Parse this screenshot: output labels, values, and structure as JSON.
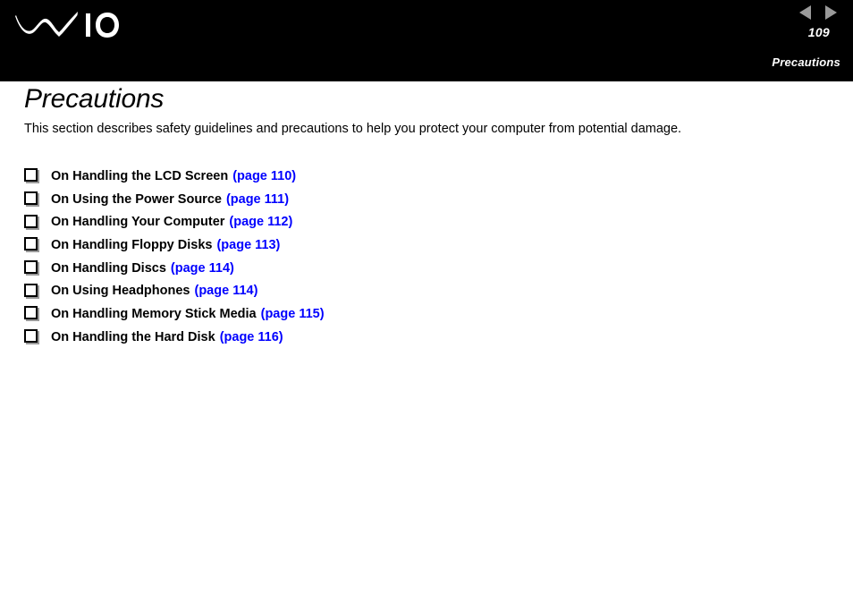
{
  "header": {
    "logo_name": "vaio-logo",
    "logo_text": "VAIO",
    "prev_arrow_label": "◀",
    "next_arrow_label": "▶",
    "page_number": "109",
    "section_label": "Precautions",
    "arrow_color": "#9a9a9a",
    "band_color": "#000000",
    "text_color": "#ffffff"
  },
  "main": {
    "title": "Precautions",
    "intro": "This section describes safety guidelines and precautions to help you protect your computer from potential damage.",
    "link_color": "#0000ff",
    "items": [
      {
        "label": "On Handling the LCD Screen",
        "page_ref": "(page 110)"
      },
      {
        "label": "On Using the Power Source",
        "page_ref": "(page 111)"
      },
      {
        "label": "On Handling Your Computer",
        "page_ref": "(page 112)"
      },
      {
        "label": "On Handling Floppy Disks",
        "page_ref": "(page 113)"
      },
      {
        "label": "On Handling Discs",
        "page_ref": "(page 114)"
      },
      {
        "label": "On Using Headphones",
        "page_ref": "(page 114)"
      },
      {
        "label": "On Handling Memory Stick Media",
        "page_ref": "(page 115)"
      },
      {
        "label": "On Handling the Hard Disk",
        "page_ref": "(page 116)"
      }
    ]
  }
}
